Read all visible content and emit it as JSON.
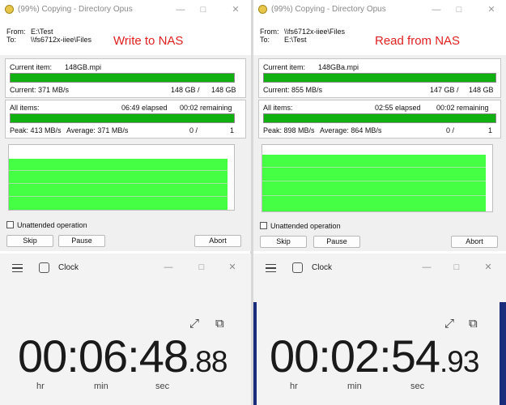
{
  "left": {
    "title": "(99%) Copying - Directory Opus",
    "from_label": "From:",
    "from_value": "E:\\Test",
    "to_label": "To:",
    "to_value": "\\\\fs6712x-iiee\\Files",
    "annotation": "Write to NAS",
    "current_item_label": "Current item:",
    "current_item_value": "148GB.mpi",
    "current_speed": "Current: 371 MB/s",
    "current_size": "148 GB /",
    "current_total": "148 GB",
    "current_progress": 1.0,
    "all_items_label": "All items:",
    "elapsed": "06:49 elapsed",
    "remaining": "00:02 remaining",
    "all_progress": 1.0,
    "peak": "Peak: 413 MB/s",
    "average": "Average: 371 MB/s",
    "count": "0 /",
    "count_total": "1",
    "unattended_label": "Unattended operation",
    "skip_label": "Skip",
    "pause_label": "Pause",
    "abort_label": "Abort",
    "clock_title": "Clock",
    "time_main": "00:06:48",
    "time_frac": ".88",
    "unit_hr": "hr",
    "unit_min": "min",
    "unit_sec": "sec"
  },
  "right": {
    "title": "(99%) Copying - Directory Opus",
    "from_label": "From:",
    "from_value": "\\\\fs6712x-iiee\\Files",
    "to_label": "To:",
    "to_value": "E:\\Test",
    "annotation": "Read from NAS",
    "current_item_label": "Current item:",
    "current_item_value": "148GBa.mpi",
    "current_speed": "Current: 855 MB/s",
    "current_size": "147 GB /",
    "current_total": "148 GB",
    "current_progress": 1.0,
    "all_items_label": "All items:",
    "elapsed": "02:55 elapsed",
    "remaining": "00:02 remaining",
    "all_progress": 1.0,
    "peak": "Peak: 898 MB/s",
    "average": "Average: 864 MB/s",
    "count": "0 /",
    "count_total": "1",
    "unattended_label": "Unattended operation",
    "skip_label": "Skip",
    "pause_label": "Pause",
    "abort_label": "Abort",
    "clock_title": "Clock",
    "time_main": "00:02:54",
    "time_frac": ".93",
    "unit_hr": "hr",
    "unit_min": "min",
    "unit_sec": "sec"
  },
  "icons": {
    "minimize": "minimize-icon",
    "maximize": "maximize-icon",
    "close": "close-icon",
    "expand": "expand-icon",
    "pin": "pin-icon",
    "menu": "hamburger-menu-icon",
    "clock": "clock-app-icon",
    "opus": "directory-opus-icon"
  },
  "colors": {
    "progress": "#10b010",
    "graph": "#44ff44",
    "annotation": "#e02020"
  }
}
